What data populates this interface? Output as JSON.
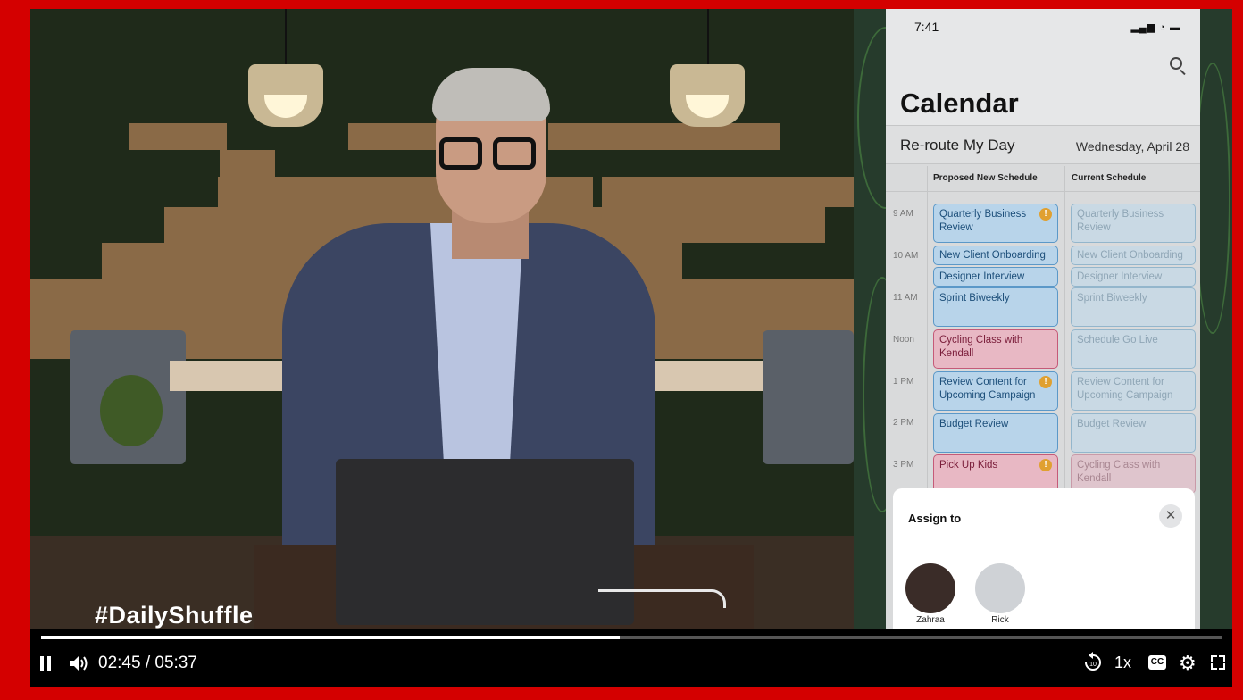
{
  "video": {
    "overlay_text": "#DailyShuffle",
    "current_time": "02:45",
    "separator": "/",
    "duration": "05:37",
    "progress": 0.49,
    "playback_rate": "1x",
    "captions_label": "CC",
    "rewind_label": "10"
  },
  "phone": {
    "time": "7:41",
    "title": "Calendar",
    "subtitle": "Re-route My Day",
    "date": "Wednesday, April 28",
    "col_proposed": "Proposed New Schedule",
    "col_current": "Current Schedule",
    "times": [
      "9 AM",
      "10 AM",
      "11 AM",
      "Noon",
      "1 PM",
      "2 PM",
      "3 PM"
    ],
    "proposed": [
      {
        "title": "Quarterly Business Review",
        "color": "blue",
        "warn": true
      },
      {
        "title": "New Client Onboarding",
        "color": "blue",
        "warn": false
      },
      {
        "title": "Designer Interview",
        "color": "blue",
        "warn": false
      },
      {
        "title": "Sprint Biweekly",
        "color": "blue",
        "warn": false
      },
      {
        "title": "Cycling Class with Kendall",
        "color": "pink",
        "warn": false
      },
      {
        "title": "Review Content for Upcoming Campaign",
        "color": "blue",
        "warn": true
      },
      {
        "title": "Budget Review",
        "color": "blue",
        "warn": false
      },
      {
        "title": "Pick Up Kids",
        "color": "pink",
        "warn": true
      }
    ],
    "current": [
      {
        "title": "Quarterly Business Review",
        "color": "blue"
      },
      {
        "title": "New Client Onboarding",
        "color": "blue"
      },
      {
        "title": "Designer Interview",
        "color": "blue"
      },
      {
        "title": "Sprint Biweekly",
        "color": "blue"
      },
      {
        "title": "Schedule Go Live",
        "color": "blue"
      },
      {
        "title": "Review Content for Upcoming Campaign",
        "color": "blue"
      },
      {
        "title": "Budget Review",
        "color": "blue"
      },
      {
        "title": "Cycling Class with Kendall",
        "color": "pink"
      }
    ],
    "assign": {
      "title": "Assign to",
      "close": "✕",
      "people": [
        "Zahraa",
        "Rick"
      ]
    }
  },
  "colors": {
    "frame": "#d40000",
    "event_blue": "#b8d4ea",
    "event_pink": "#e8b8c4"
  }
}
